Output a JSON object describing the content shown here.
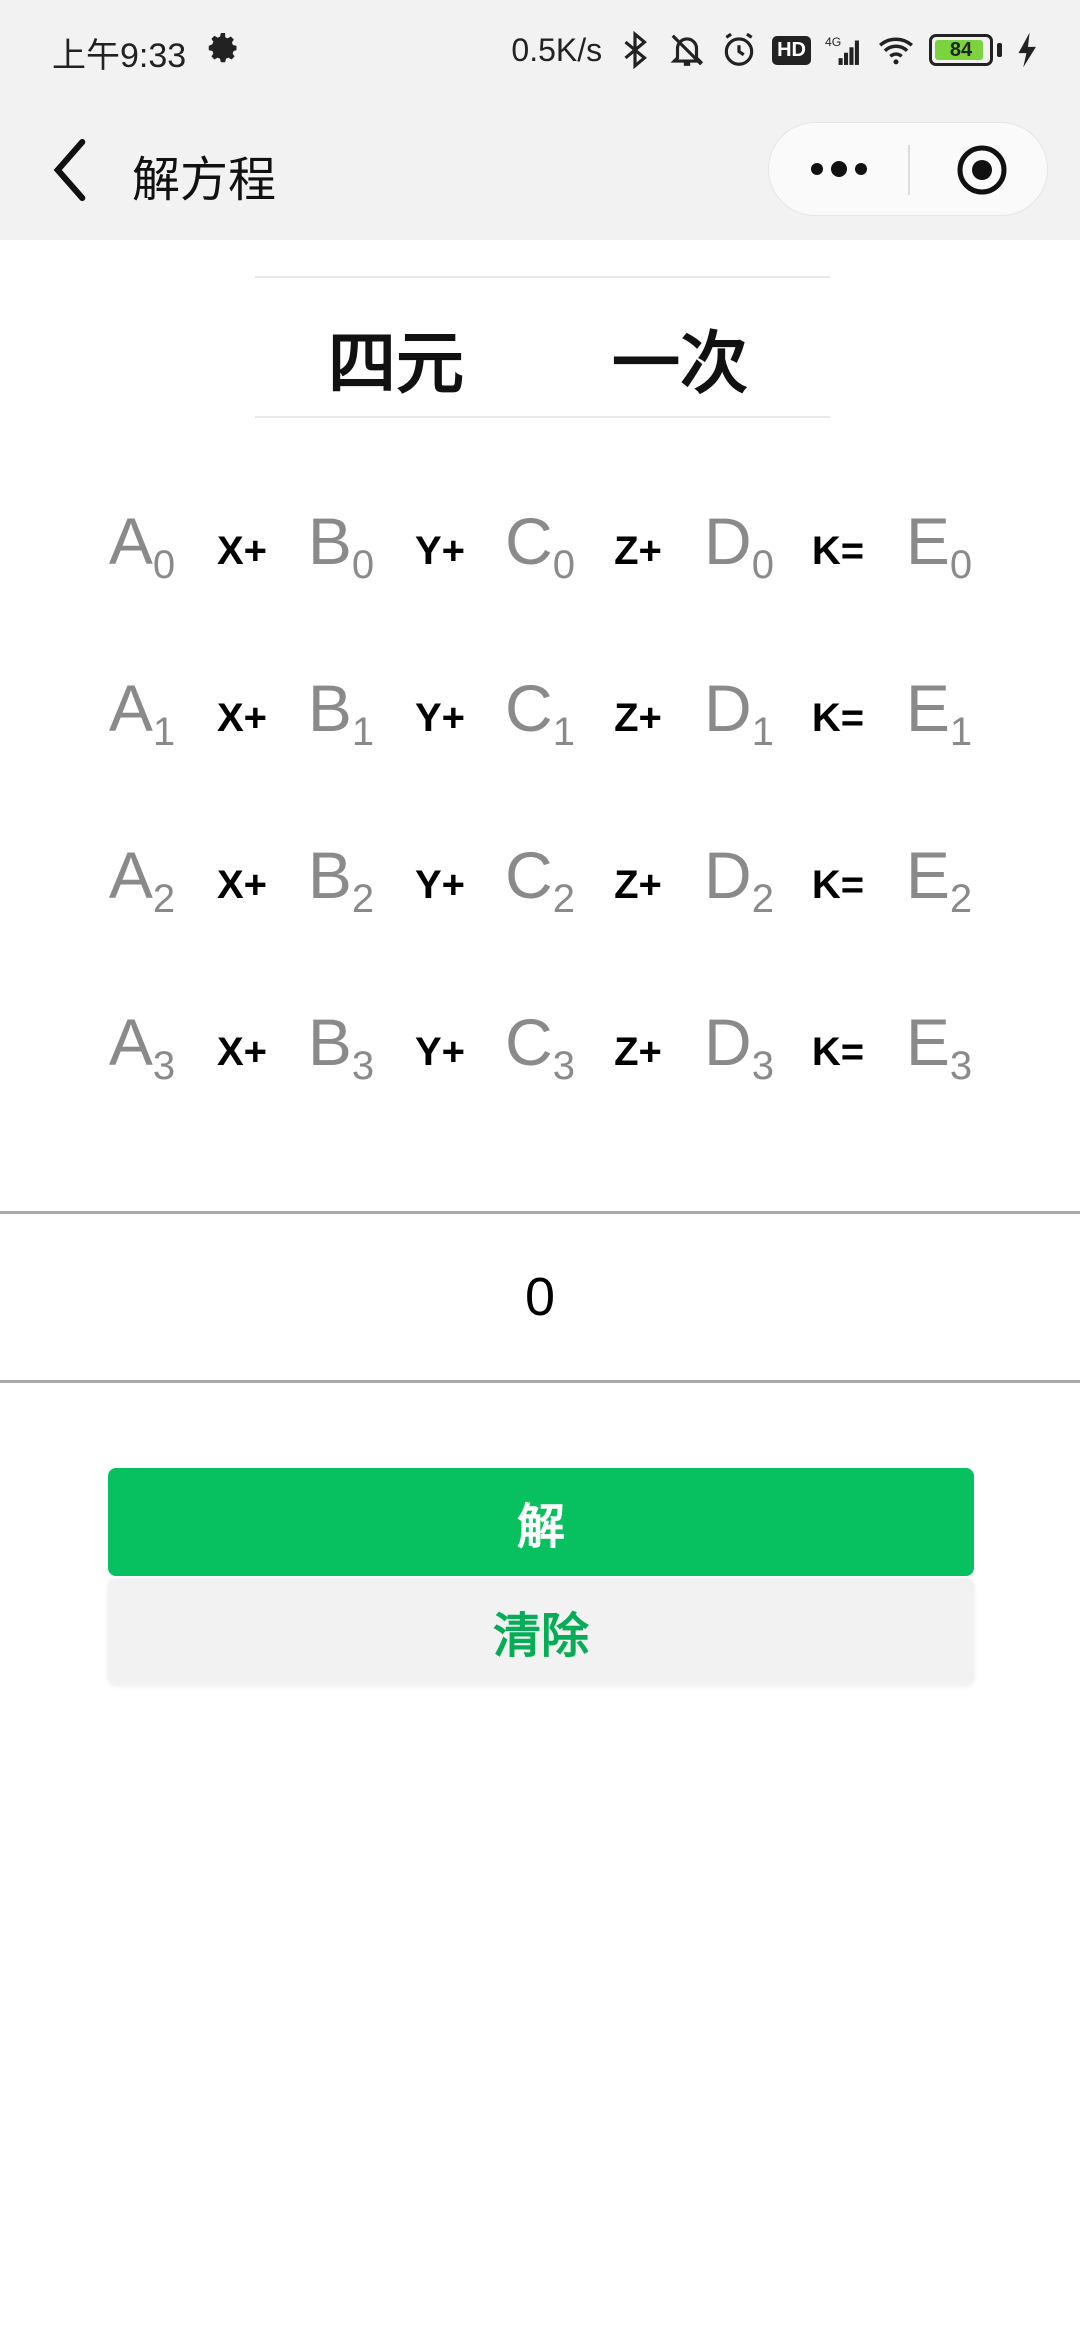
{
  "status_bar": {
    "time": "上午9:33",
    "net_speed": "0.5K/s",
    "hd": "HD",
    "signal": "4G",
    "battery": "84"
  },
  "nav": {
    "title": "解方程"
  },
  "selector": {
    "left": "四元",
    "right": "一次"
  },
  "equations": [
    {
      "a": "A",
      "b": "B",
      "c": "C",
      "d": "D",
      "e": "E",
      "sub": "0",
      "ops": [
        "X+",
        "Y+",
        "Z+",
        "K="
      ]
    },
    {
      "a": "A",
      "b": "B",
      "c": "C",
      "d": "D",
      "e": "E",
      "sub": "1",
      "ops": [
        "X+",
        "Y+",
        "Z+",
        "K="
      ]
    },
    {
      "a": "A",
      "b": "B",
      "c": "C",
      "d": "D",
      "e": "E",
      "sub": "2",
      "ops": [
        "X+",
        "Y+",
        "Z+",
        "K="
      ]
    },
    {
      "a": "A",
      "b": "B",
      "c": "C",
      "d": "D",
      "e": "E",
      "sub": "3",
      "ops": [
        "X+",
        "Y+",
        "Z+",
        "K="
      ]
    }
  ],
  "result": {
    "value": "0"
  },
  "buttons": {
    "solve": "解",
    "clear": "清除"
  },
  "colors": {
    "primary": "#07c160",
    "secondary_text": "#06ad56",
    "placeholder": "#8a8a8a"
  },
  "icons": [
    "gear-icon",
    "bluetooth-icon",
    "mute-bell-icon",
    "alarm-icon",
    "signal-icon",
    "wifi-icon",
    "battery-icon",
    "charging-icon",
    "back-arrow-icon",
    "more-dots-icon",
    "close-target-icon"
  ]
}
